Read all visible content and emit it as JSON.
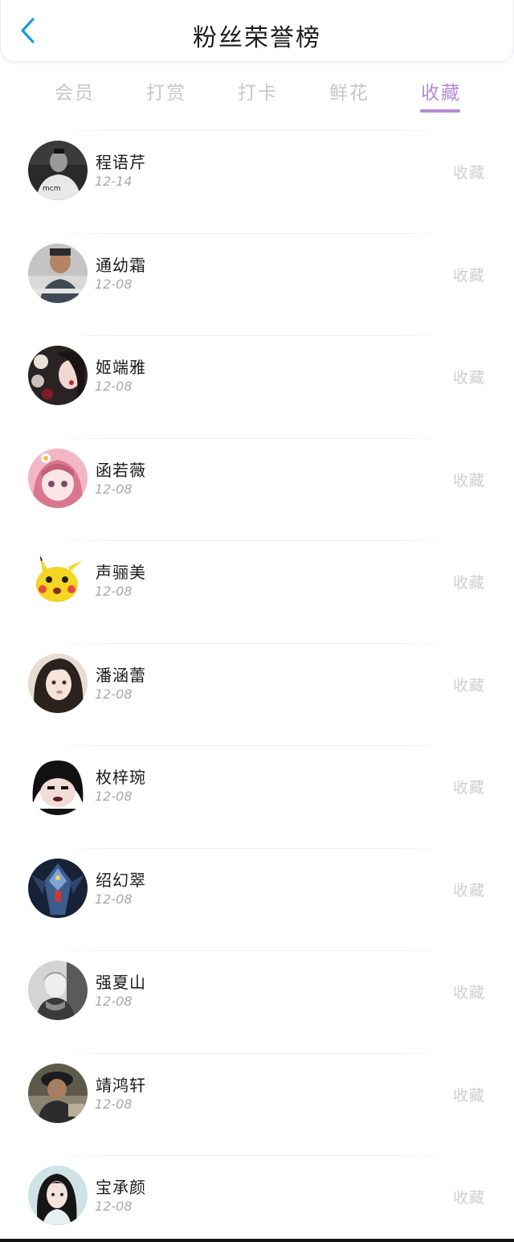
{
  "header": {
    "title": "粉丝荣誉榜",
    "back_icon": "chevron-left-icon",
    "accent_color": "#1a9fe0"
  },
  "tabs": [
    {
      "label": "会员",
      "active": false
    },
    {
      "label": "打赏",
      "active": false
    },
    {
      "label": "打卡",
      "active": false
    },
    {
      "label": "鲜花",
      "active": false
    },
    {
      "label": "收藏",
      "active": true
    }
  ],
  "tab_active_color": "#b48ad6",
  "fans": [
    {
      "name": "程语芹",
      "date": "12-14",
      "action": "收藏",
      "avatar": "avatar-photo-man-mono"
    },
    {
      "name": "通幼霜",
      "date": "12-08",
      "action": "收藏",
      "avatar": "avatar-photo-man"
    },
    {
      "name": "姬端雅",
      "date": "12-08",
      "action": "收藏",
      "avatar": "avatar-photo-woman-flowers"
    },
    {
      "name": "函若薇",
      "date": "12-08",
      "action": "收藏",
      "avatar": "avatar-anime-girl"
    },
    {
      "name": "声骊美",
      "date": "12-08",
      "action": "收藏",
      "avatar": "avatar-pikachu"
    },
    {
      "name": "潘涵蕾",
      "date": "12-08",
      "action": "收藏",
      "avatar": "avatar-photo-woman"
    },
    {
      "name": "枚梓琬",
      "date": "12-08",
      "action": "收藏",
      "avatar": "avatar-meme-face"
    },
    {
      "name": "绍幻翠",
      "date": "12-08",
      "action": "收藏",
      "avatar": "avatar-robot"
    },
    {
      "name": "强夏山",
      "date": "12-08",
      "action": "收藏",
      "avatar": "avatar-photo-woman-mono"
    },
    {
      "name": "靖鸿轩",
      "date": "12-08",
      "action": "收藏",
      "avatar": "avatar-photo-man-dark"
    },
    {
      "name": "宝承颜",
      "date": "12-08",
      "action": "收藏",
      "avatar": "avatar-photo-girl"
    }
  ]
}
